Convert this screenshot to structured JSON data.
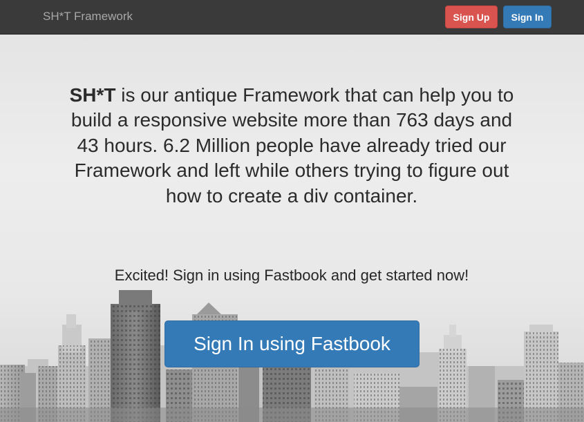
{
  "navbar": {
    "brand": "SH*T Framework",
    "signup_label": "Sign Up",
    "signin_label": "Sign In"
  },
  "hero": {
    "headline_strong": "SH*T",
    "headline_rest": " is our antique Framework that can help you to build a responsive website more than 763 days and 43 hours. 6.2 Million people have already tried our Framework and left while others trying to figure out how to create a div container.",
    "subline": "Excited! Sign in using Fastbook and get started now!",
    "cta_label": "Sign In using Fastbook"
  },
  "colors": {
    "navbar_bg": "#3a3a3a",
    "signup_red": "#d9534f",
    "primary_blue": "#337ab7"
  }
}
